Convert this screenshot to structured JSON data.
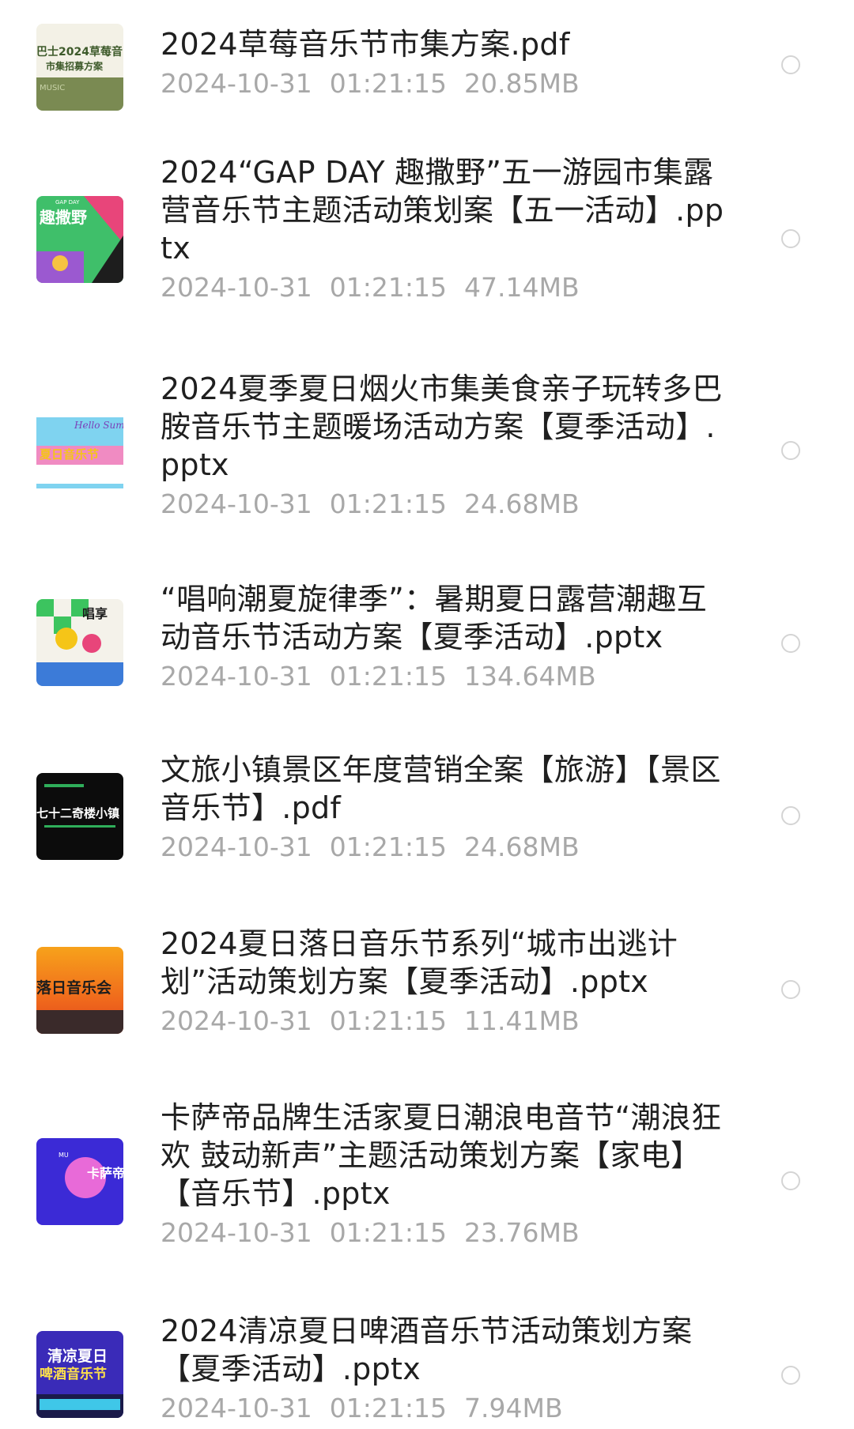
{
  "files": [
    {
      "name": "2024草莓音乐节市集方案.pdf",
      "date": "2024-10-31",
      "time": "01:21:15",
      "size": "20.85MB",
      "thumb": {
        "icon": "strawberry-festival-thumbnail",
        "text1": "巴士2024草莓音",
        "text2": "市集招募方案",
        "text3": "MUSIC"
      }
    },
    {
      "name": "2024“GAP DAY 趣撒野”五一游园市集露营音乐节主题活动策划案【五一活动】.pptx",
      "date": "2024-10-31",
      "time": "01:21:15",
      "size": "47.14MB",
      "thumb": {
        "icon": "gap-day-thumbnail",
        "text1": "趣撒野",
        "text2": "GAP DAY"
      }
    },
    {
      "name": "2024夏季夏日烟火市集美食亲子玩转多巴胺音乐节主题暖场活动方案【夏季活动】.pptx",
      "date": "2024-10-31",
      "time": "01:21:15",
      "size": "24.68MB",
      "thumb": {
        "icon": "summer-fireworks-thumbnail",
        "text1": "Hello Summer",
        "text2": "夏日音乐节"
      }
    },
    {
      "name": "“唱响潮夏旋律季”：暑期夏日露营潮趣互动音乐节活动方案【夏季活动】.pptx",
      "date": "2024-10-31",
      "time": "01:21:15",
      "size": "134.64MB",
      "thumb": {
        "icon": "summer-melody-thumbnail",
        "text1": "唱享"
      }
    },
    {
      "name": "文旅小镇景区年度营销全案【旅游】【景区音乐节】.pdf",
      "date": "2024-10-31",
      "time": "01:21:15",
      "size": "24.68MB",
      "thumb": {
        "icon": "scenic-town-thumbnail",
        "text1": "七十二奇楼小镇"
      }
    },
    {
      "name": "2024夏日落日音乐节系列“城市出逃计划”活动策划方案【夏季活动】.pptx",
      "date": "2024-10-31",
      "time": "01:21:15",
      "size": "11.41MB",
      "thumb": {
        "icon": "sunset-festival-thumbnail",
        "text1": "落日音乐会"
      }
    },
    {
      "name": "卡萨帝品牌生活家夏日潮浪电音节“潮浪狂欢 鼓动新声”主题活动策划方案【家电】【音乐节】.pptx",
      "date": "2024-10-31",
      "time": "01:21:15",
      "size": "23.76MB",
      "thumb": {
        "icon": "casarte-thumbnail",
        "text1": "卡萨帝",
        "text2": "MU"
      }
    },
    {
      "name": "2024清凉夏日啤酒音乐节活动策划方案【夏季活动】.pptx",
      "date": "2024-10-31",
      "time": "01:21:15",
      "size": "7.94MB",
      "thumb": {
        "icon": "beer-festival-thumbnail",
        "text1": "清凉夏日",
        "text2": "啤酒音乐节"
      }
    }
  ]
}
